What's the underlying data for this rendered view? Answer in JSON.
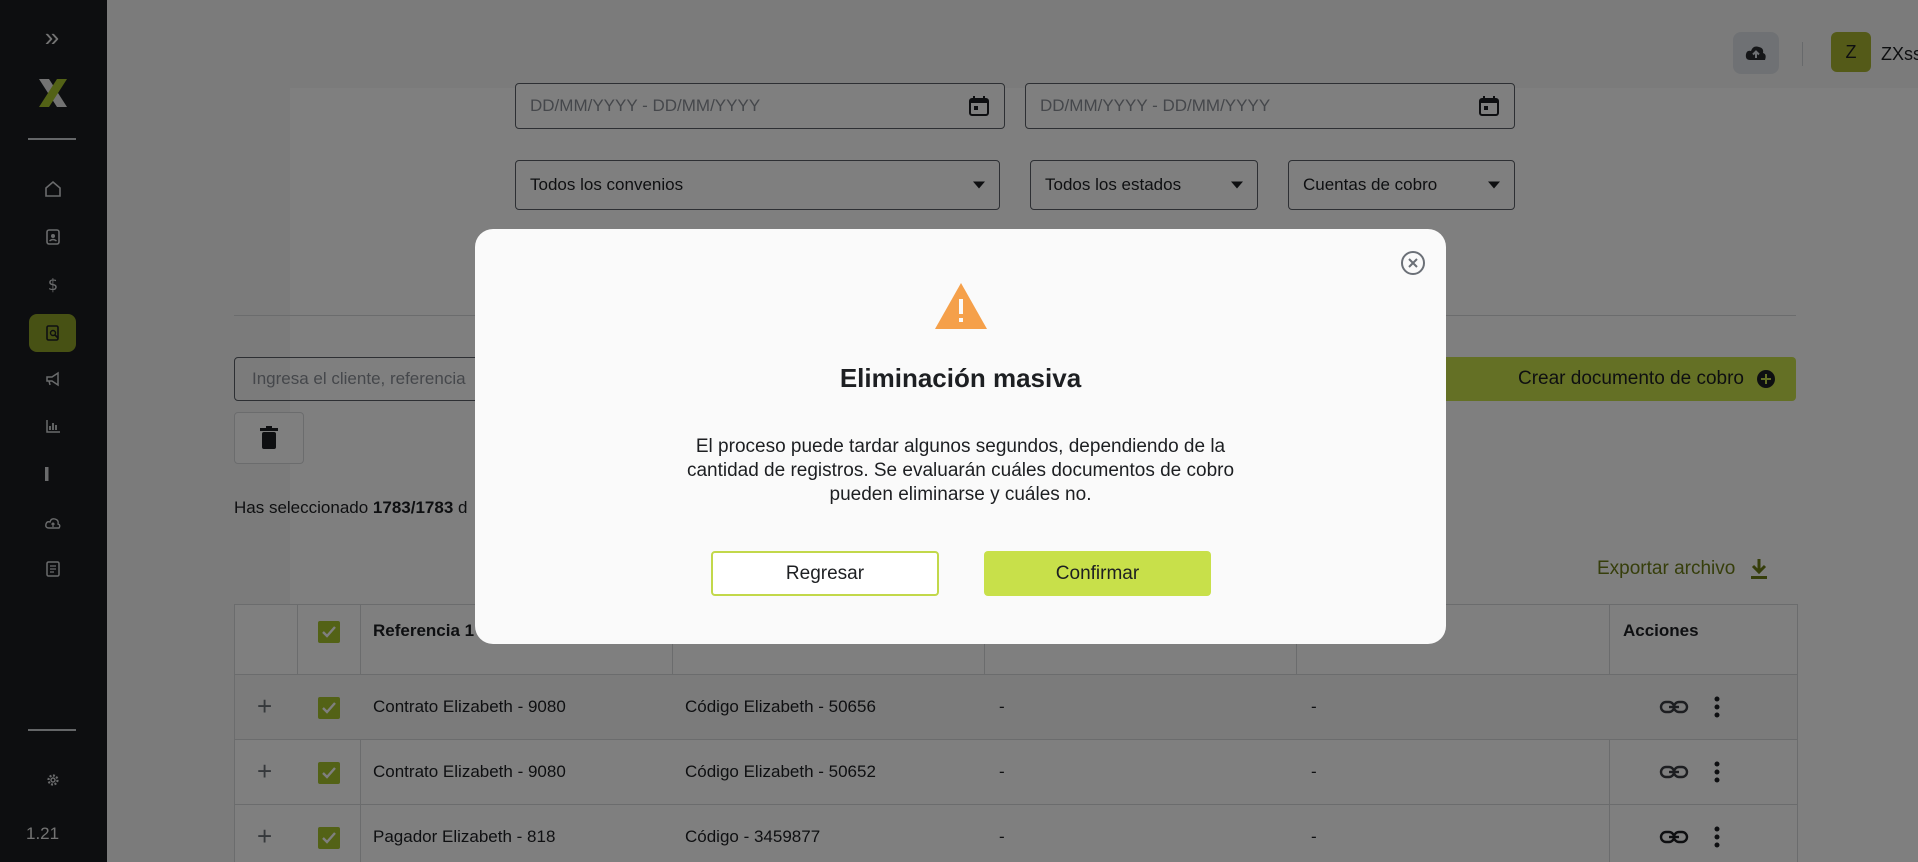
{
  "app": {
    "version": "1.21"
  },
  "sidebar": {
    "items": [
      {
        "icon": "home-icon"
      },
      {
        "icon": "contact-icon"
      },
      {
        "icon": "dollar-icon"
      },
      {
        "icon": "document-search-icon",
        "active": true
      },
      {
        "icon": "megaphone-icon"
      },
      {
        "icon": "bar-chart-icon"
      },
      {
        "icon": "bar-icon"
      },
      {
        "icon": "cloud-upload-icon"
      },
      {
        "icon": "document-icon"
      }
    ],
    "settings_icon": "gear-icon"
  },
  "header": {
    "avatar_initial": "Z",
    "user_name": "ZXsss"
  },
  "filters": {
    "date_range_1_placeholder": "DD/MM/YYYY - DD/MM/YYYY",
    "date_range_2_placeholder": "DD/MM/YYYY - DD/MM/YYYY",
    "convenios": "Todos los convenios",
    "estados": "Todos los estados",
    "cuentas": "Cuentas de cobro"
  },
  "toolbar": {
    "search_placeholder": "Ingresa el cliente, referencia",
    "create_label": "Crear documento de cobro",
    "selection_prefix": "Has seleccionado ",
    "selection_count": "1783/1783",
    "selection_suffix": " d",
    "export_label": "Exportar archivo"
  },
  "table": {
    "headers": {
      "ref1": "Referencia 1",
      "actions": "Acciones"
    },
    "rows": [
      {
        "ref1": "Contrato Elizabeth - 9080",
        "ref2": "Código Elizabeth - 50656",
        "c3": "-",
        "c4": "-"
      },
      {
        "ref1": "Contrato Elizabeth - 9080",
        "ref2": "Código Elizabeth - 50652",
        "c3": "-",
        "c4": "-"
      },
      {
        "ref1": "Pagador Elizabeth - 818",
        "ref2": "Código - 3459877",
        "c3": "-",
        "c4": "-"
      }
    ]
  },
  "modal": {
    "title": "Eliminación masiva",
    "body": "El proceso puede tardar algunos segundos, dependiendo de la cantidad de registros. Se evaluarán cuáles documentos de cobro pueden eliminarse y cuáles no.",
    "back_label": "Regresar",
    "confirm_label": "Confirmar"
  },
  "colors": {
    "accent": "#c8e04a",
    "sidebar_bg": "#1a1d20",
    "warning": "#f5a04a"
  }
}
